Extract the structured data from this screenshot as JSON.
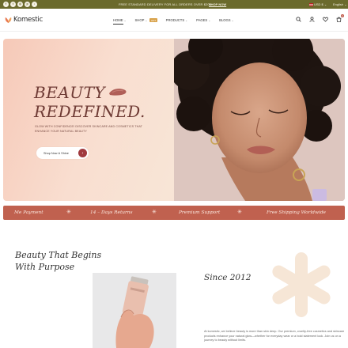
{
  "topbar": {
    "socials": [
      {
        "icon": "facebook-icon",
        "glyph": "f"
      },
      {
        "icon": "twitter-icon",
        "glyph": "t"
      },
      {
        "icon": "instagram-icon",
        "glyph": "◎"
      },
      {
        "icon": "pinterest-icon",
        "glyph": "p"
      },
      {
        "icon": "tiktok-icon",
        "glyph": "♪"
      }
    ],
    "announcement": "FREE STANDARD DELIVERY FOR ALL ORDERS OVER $200",
    "shop_now": "SHOP NOW",
    "currency": "USD $",
    "language": "English"
  },
  "header": {
    "logo_text": "Komestic",
    "nav": [
      {
        "label": "HOME",
        "active": true,
        "badge": ""
      },
      {
        "label": "SHOP",
        "active": false,
        "badge": "HOT"
      },
      {
        "label": "PRODUCTS",
        "active": false,
        "badge": ""
      },
      {
        "label": "PAGES",
        "active": false,
        "badge": ""
      },
      {
        "label": "BLOGS",
        "active": false,
        "badge": ""
      }
    ],
    "icons": [
      "search-icon",
      "user-icon",
      "heart-icon",
      "cart-icon"
    ],
    "cart_count": "0"
  },
  "hero": {
    "title_line1": "BEAUTY",
    "title_line2": "REDEFINED.",
    "subtitle": "GLOW WITH CONFIDENCE! DISCOVER SKINCARE AND COSMETICS THAT ENHANCE YOUR NATURAL BEAUTY",
    "button_label": "Shop Now & Shine"
  },
  "band": {
    "items": [
      "Me Payment",
      "14 – Days Returns",
      "Premium Support",
      "Free Shipping Worldwide"
    ]
  },
  "about": {
    "title_line1": "Beauty That Begins",
    "title_line2": "With Purpose",
    "since": "Since 2012",
    "text": "At komestic, we believe beauty is more than skin deep. Our premium, cruelty-free cosmetics and skincare products enhance your natural glow—whether for everyday wear or a bold statement look. Join us on a journey to beauty without limits."
  },
  "colors": {
    "topbar": "#6b6a2c",
    "accent": "#c0614f",
    "button_circle": "#a03a3f",
    "hero_title": "#6e3a34"
  }
}
